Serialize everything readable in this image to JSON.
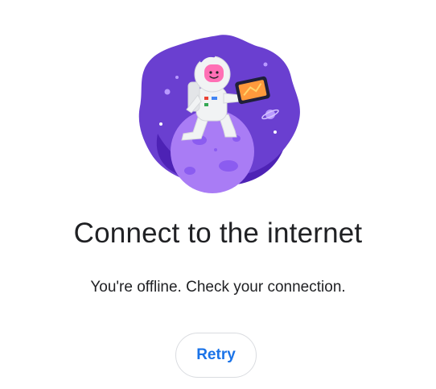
{
  "illustration": {
    "subject": "astronaut-on-planet-with-tablet",
    "colors": {
      "background_blob": "#6a3fd0",
      "background_blob_dark": "#4d22b5",
      "planet": "#a97cf5",
      "planet_craters": "#8b5cf0",
      "suit": "#f1f3f4",
      "visor": "#ff6fb5",
      "tablet_frame": "#1f1f3a",
      "tablet_screen": "#ff9a3c"
    }
  },
  "message": {
    "title": "Connect to the internet",
    "subtitle": "You're offline. Check your connection."
  },
  "actions": {
    "retry_label": "Retry"
  },
  "colors": {
    "accent": "#1a73e8",
    "text": "#202124",
    "border": "#dadce0"
  }
}
